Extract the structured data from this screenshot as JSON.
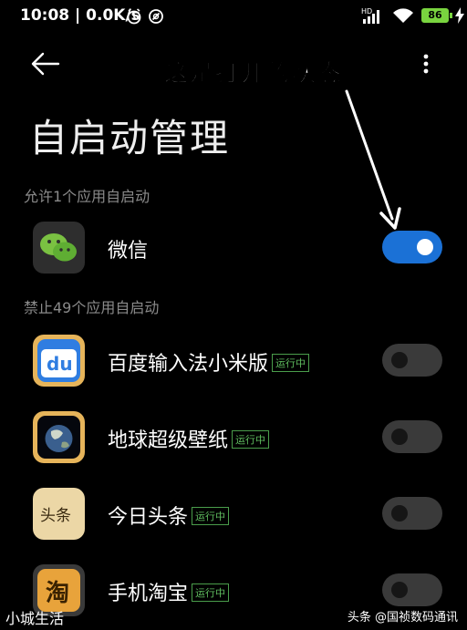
{
  "status_bar": {
    "time": "10:08",
    "speed": "0.0K/s",
    "battery": "86",
    "network": "HD"
  },
  "annotation": "这是打开的状态",
  "page_title": "自启动管理",
  "sections": {
    "allowed": "允许1个应用自启动",
    "blocked": "禁止49个应用自启动"
  },
  "apps": [
    {
      "name": "微信",
      "badge": "",
      "enabled": true,
      "icon": "wechat-icon"
    },
    {
      "name": "百度输入法小米版",
      "badge": "运行中",
      "enabled": false,
      "icon": "baidu-input-icon"
    },
    {
      "name": "地球超级壁纸",
      "badge": "运行中",
      "enabled": false,
      "icon": "earth-wallpaper-icon"
    },
    {
      "name": "今日头条",
      "badge": "运行中",
      "enabled": false,
      "icon": "toutiao-icon"
    },
    {
      "name": "手机淘宝",
      "badge": "运行中",
      "enabled": false,
      "icon": "taobao-icon"
    }
  ],
  "icon_labels": {
    "baidu": "du",
    "toutiao": "头条",
    "taobao": "淘"
  },
  "watermarks": {
    "left": "小城生活",
    "right": "头条 @国祯数码通讯"
  }
}
